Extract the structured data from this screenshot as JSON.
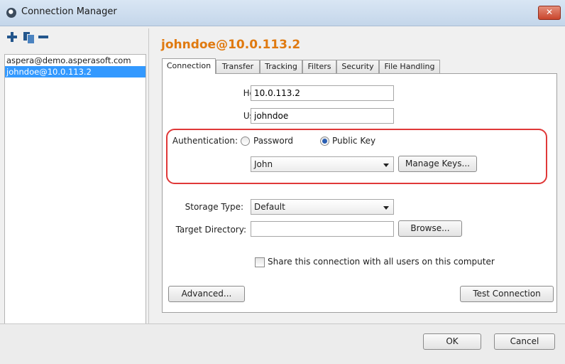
{
  "window": {
    "title": "Connection Manager",
    "close_label": "✕"
  },
  "toolbar": {
    "add": "add-connection",
    "duplicate": "duplicate-connection",
    "remove": "remove-connection"
  },
  "connections": [
    {
      "label": "aspera@demo.asperasoft.com",
      "selected": false
    },
    {
      "label": "johndoe@10.0.113.2",
      "selected": true
    }
  ],
  "detail": {
    "title": "johndoe@10.0.113.2",
    "tabs": [
      "Connection",
      "Transfer",
      "Tracking",
      "Filters",
      "Security",
      "File Handling"
    ],
    "active_tab": "Connection",
    "host_label": "Host:",
    "host_value": "10.0.113.2",
    "user_label": "User:",
    "user_value": "johndoe",
    "auth_label": "Authentication:",
    "auth_password_label": "Password",
    "auth_publickey_label": "Public Key",
    "auth_selected": "Public Key",
    "key_selected": "John",
    "manage_keys_label": "Manage Keys...",
    "storage_label": "Storage Type:",
    "storage_value": "Default",
    "target_label": "Target Directory:",
    "target_value": "",
    "browse_label": "Browse...",
    "share_label": "Share this connection with all users on this computer",
    "share_checked": false,
    "advanced_label": "Advanced...",
    "test_label": "Test Connection"
  },
  "footer": {
    "ok_label": "OK",
    "cancel_label": "Cancel"
  },
  "colors": {
    "title_accent": "#e07a10",
    "selection": "#3399ff",
    "highlight_box": "#e03838",
    "icon_blue": "#23568c"
  }
}
